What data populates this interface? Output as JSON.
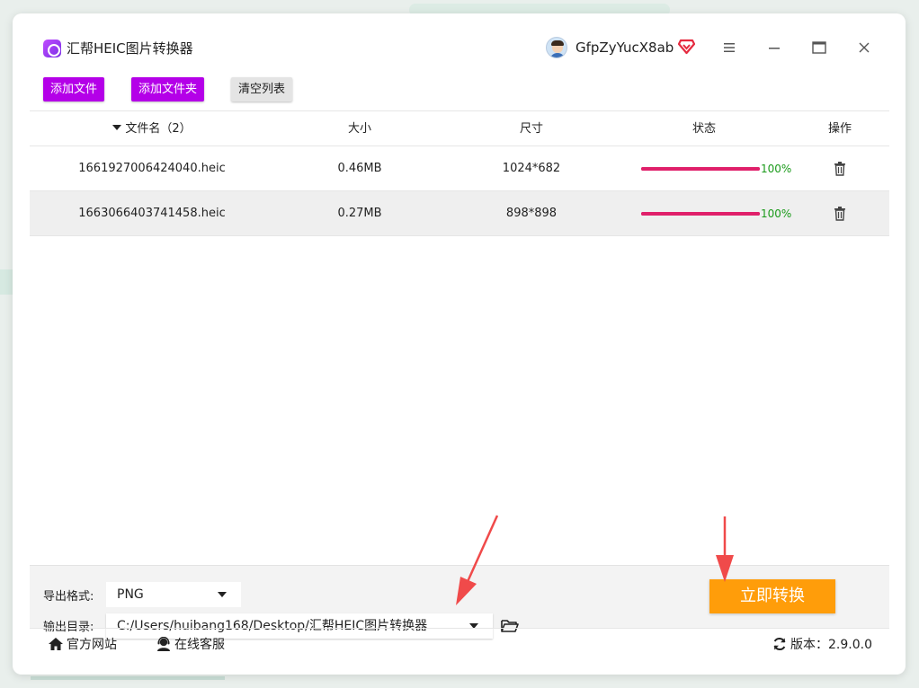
{
  "app": {
    "title": "汇帮HEIC图片转换器",
    "username": "GfpZyYucX8ab"
  },
  "toolbar": {
    "add_file": "添加文件",
    "add_folder": "添加文件夹",
    "clear_list": "清空列表"
  },
  "table": {
    "headers": {
      "name": "文件名（2）",
      "size": "大小",
      "dimensions": "尺寸",
      "status": "状态",
      "action": "操作"
    },
    "rows": [
      {
        "name": "1661927006424040.heic",
        "size": "0.46MB",
        "dimensions": "1024*682",
        "progress": 100,
        "progress_text": "100%"
      },
      {
        "name": "1663066403741458.heic",
        "size": "0.27MB",
        "dimensions": "898*898",
        "progress": 100,
        "progress_text": "100%"
      }
    ]
  },
  "settings": {
    "format_label": "导出格式:",
    "format_value": "PNG",
    "outdir_label": "输出目录:",
    "outdir_value": "C:/Users/huibang168/Desktop/汇帮HEIC图片转换器"
  },
  "convert_button": "立即转换",
  "footer": {
    "website": "官方网站",
    "support": "在线客服",
    "version": "版本：2.9.0.0"
  },
  "colors": {
    "accent": "#b400e8",
    "convert": "#ff9d0a",
    "progress": "#e0206a",
    "success": "#1a9a1a",
    "arrow": "#f04a4a"
  }
}
